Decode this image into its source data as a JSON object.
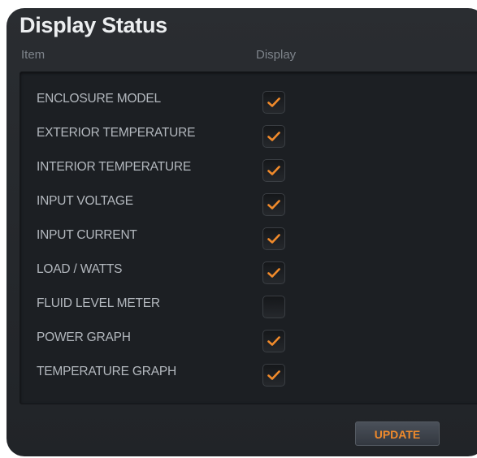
{
  "title": "Display Status",
  "columns": {
    "item": "Item",
    "display": "Display"
  },
  "rows": [
    {
      "label": "ENCLOSURE MODEL",
      "checked": true
    },
    {
      "label": "EXTERIOR TEMPERATURE",
      "checked": true
    },
    {
      "label": "INTERIOR TEMPERATURE",
      "checked": true
    },
    {
      "label": "INPUT VOLTAGE",
      "checked": true
    },
    {
      "label": "INPUT CURRENT",
      "checked": true
    },
    {
      "label": "LOAD / WATTS",
      "checked": true
    },
    {
      "label": "FLUID LEVEL METER",
      "checked": false
    },
    {
      "label": "POWER GRAPH",
      "checked": true
    },
    {
      "label": "TEMPERATURE GRAPH",
      "checked": true
    }
  ],
  "update_label": "UPDATE",
  "colors": {
    "accent": "#f08a2b",
    "panel": "#2a2d31",
    "inner": "#1c1f23",
    "label": "#b3b8be"
  }
}
